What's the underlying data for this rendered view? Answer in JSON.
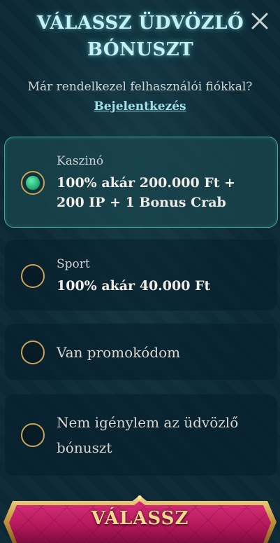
{
  "header": {
    "title_line1": "VÁLASSZ ÜDVÖZLŐ",
    "title_line2": "BÓNUSZT",
    "close_icon": "close-icon"
  },
  "login": {
    "question": "Már rendelkezel felhasználói fiókkal?",
    "link": "Bejelentkezés"
  },
  "options": [
    {
      "category": "Kaszinó",
      "line1": "100% akár 200.000 Ft +",
      "line2": "200 IP + 1 Bonus Crab",
      "selected": true
    },
    {
      "category": "Sport",
      "line1": "100% akár 40.000 Ft",
      "selected": false
    },
    {
      "label": "Van promokódom",
      "selected": false
    },
    {
      "label_line1": "Nem igénylem az üdvözlő",
      "label_line2": "bónuszt",
      "selected": false
    }
  ],
  "submit": {
    "label": "VÁLASSZ"
  },
  "colors": {
    "background": "#0c2936",
    "title": "#c6f1f2",
    "link": "#9fe0e8",
    "selected_border": "#3fa89a",
    "radio_border": "#c9a35c",
    "radio_dot": "#1fa36c",
    "button_fill": "#b3185a",
    "button_frame": "#d7b25e"
  }
}
